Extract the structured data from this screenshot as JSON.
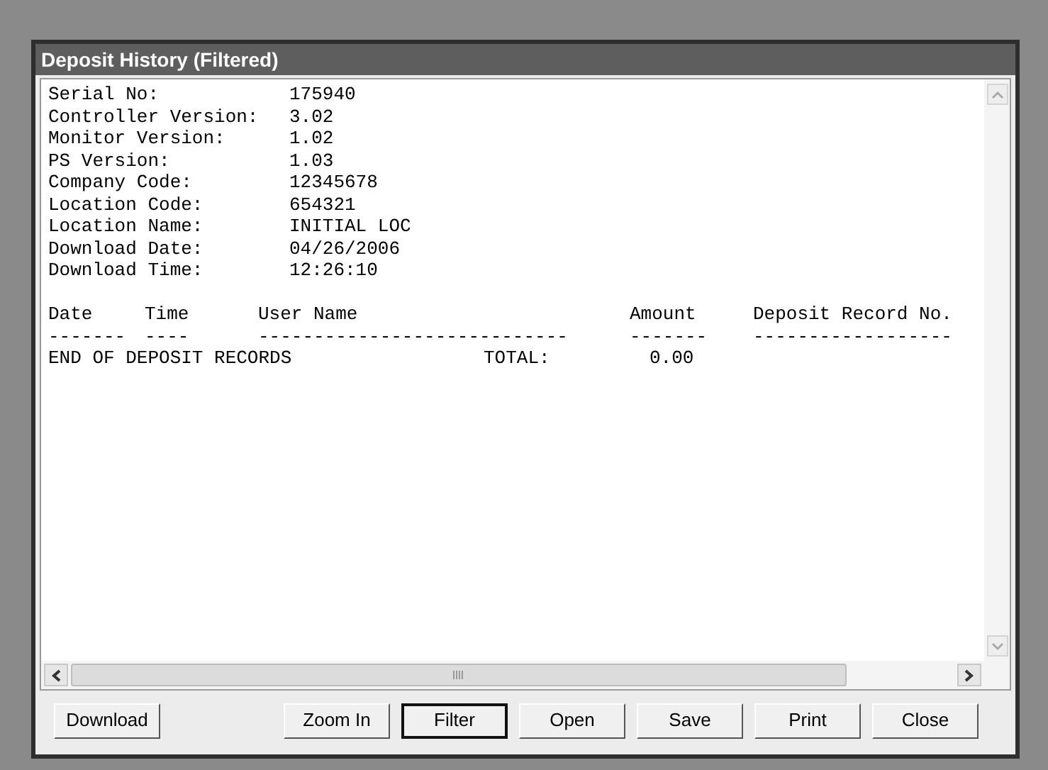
{
  "window": {
    "title": "Deposit History (Filtered)"
  },
  "report": {
    "fields": [
      {
        "label": "Serial No:",
        "value": "175940"
      },
      {
        "label": "Controller Version:",
        "value": "3.02"
      },
      {
        "label": "Monitor Version:",
        "value": "1.02"
      },
      {
        "label": "PS Version:",
        "value": "1.03"
      },
      {
        "label": "Company Code:",
        "value": "12345678"
      },
      {
        "label": "Location Code:",
        "value": "654321"
      },
      {
        "label": "Location Name:",
        "value": "INITIAL LOC"
      },
      {
        "label": "Download Date:",
        "value": "04/26/2006"
      },
      {
        "label": "Download Time:",
        "value": "12:26:10"
      }
    ],
    "columns": [
      {
        "heading": "Date",
        "rule": "-------"
      },
      {
        "heading": "Time",
        "rule": "----"
      },
      {
        "heading": "User Name",
        "rule": "----------------------------"
      },
      {
        "heading": "Amount",
        "rule": "-------"
      },
      {
        "heading": "Deposit Record No.",
        "rule": "------------------"
      }
    ],
    "footer": {
      "text": "END OF DEPOSIT RECORDS",
      "total_label": "TOTAL:",
      "total": "0.00"
    }
  },
  "buttons": [
    {
      "label": "Download",
      "focused": false
    },
    {
      "label": "Zoom In",
      "focused": false
    },
    {
      "label": "Filter",
      "focused": true
    },
    {
      "label": "Open",
      "focused": false
    },
    {
      "label": "Save",
      "focused": false
    },
    {
      "label": "Print",
      "focused": false
    },
    {
      "label": "Close",
      "focused": false
    }
  ]
}
